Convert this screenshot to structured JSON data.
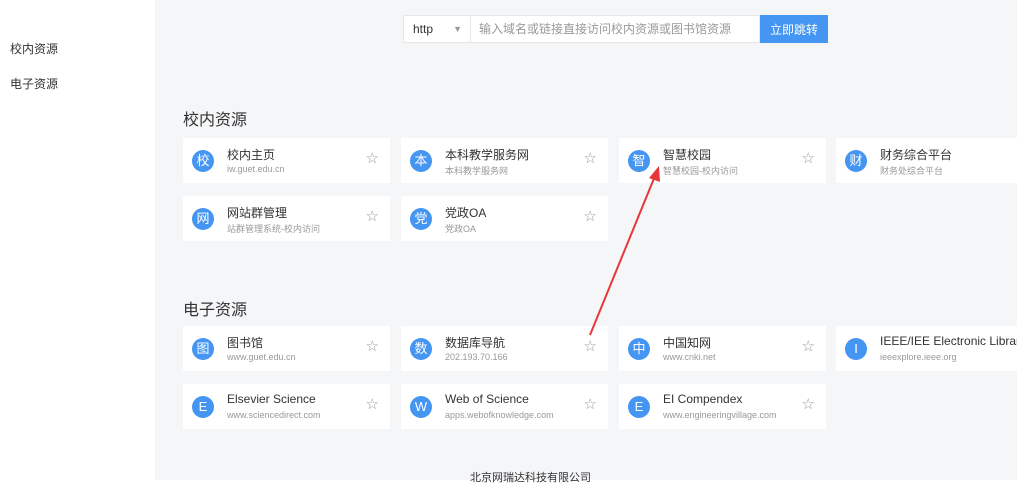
{
  "sidebar": {
    "items": [
      {
        "label": "校内资源"
      },
      {
        "label": "电子资源"
      }
    ]
  },
  "search": {
    "protocol": "http",
    "placeholder": "输入域名或链接直接访问校内资源或图书馆资源",
    "button": "立即跳转"
  },
  "sections": [
    {
      "title": "校内资源",
      "cards": [
        {
          "icon": "校",
          "name": "校内主页",
          "sub": "iw.guet.edu.cn"
        },
        {
          "icon": "本",
          "name": "本科教学服务网",
          "sub": "本科教学服务网"
        },
        {
          "icon": "智",
          "name": "智慧校园",
          "sub": "智慧校园-校内访问"
        },
        {
          "icon": "财",
          "name": "财务综合平台",
          "sub": "财务处综合平台"
        },
        {
          "icon": "网",
          "name": "网站群管理",
          "sub": "站群管理系统-校内访问"
        },
        {
          "icon": "党",
          "name": "党政OA",
          "sub": "党政OA"
        }
      ]
    },
    {
      "title": "电子资源",
      "cards": [
        {
          "icon": "图",
          "name": "图书馆",
          "sub": "www.guet.edu.cn"
        },
        {
          "icon": "数",
          "name": "数据库导航",
          "sub": "202.193.70.166"
        },
        {
          "icon": "中",
          "name": "中国知网",
          "sub": "www.cnki.net"
        },
        {
          "icon": "I",
          "name": "IEEE/IEE Electronic Library",
          "sub": "ieeexplore.ieee.org"
        },
        {
          "icon": "E",
          "name": "Elsevier Science",
          "sub": "www.sciencedirect.com"
        },
        {
          "icon": "W",
          "name": "Web of Science",
          "sub": "apps.webofknowledge.com"
        },
        {
          "icon": "E",
          "name": "EI Compendex",
          "sub": "www.engineeringvillage.com"
        }
      ]
    }
  ],
  "footer": "北京网瑞达科技有限公司",
  "colors": {
    "accent": "#4595f3",
    "annotation_arrow": "#e8363a",
    "background": "#f5f6f8"
  },
  "icons": {
    "favorite": "star-outline-icon",
    "dropdown": "caret-down-icon"
  }
}
